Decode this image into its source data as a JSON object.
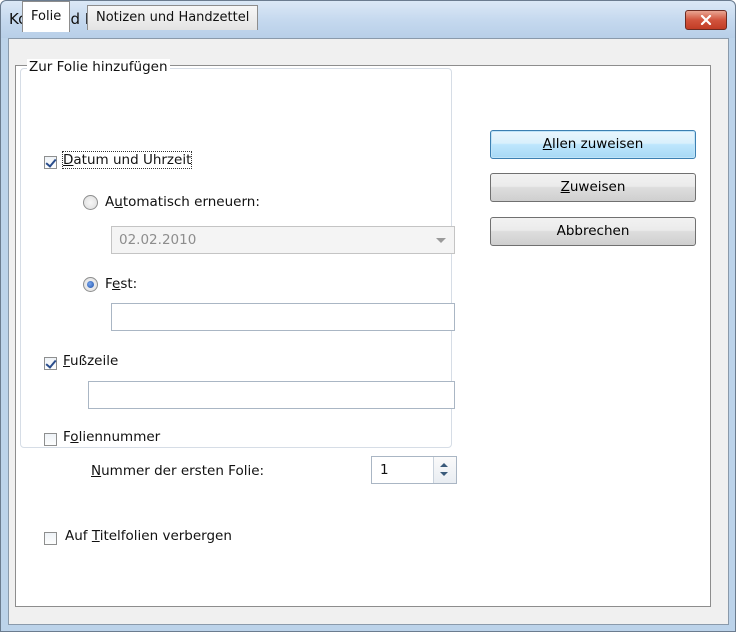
{
  "window": {
    "title": "Kopf- und Fußzeile"
  },
  "tabs": [
    {
      "label": "Folie",
      "active": true
    },
    {
      "label": "Notizen und Handzettel",
      "active": false
    }
  ],
  "group": {
    "label": "Zur Folie hinzufügen",
    "date_time": {
      "pre": "",
      "mn": "D",
      "post": "atum und Uhrzeit",
      "checked": true
    },
    "auto_update": {
      "pre": "A",
      "mn": "u",
      "post": "tomatisch erneuern:",
      "selected": false
    },
    "date_combo": {
      "value": "02.02.2010"
    },
    "fixed": {
      "pre": "F",
      "mn": "e",
      "post": "st:",
      "selected": true
    },
    "fixed_value": "",
    "footer": {
      "pre": "",
      "mn": "F",
      "post": "ußzeile",
      "checked": true
    },
    "footer_value": "",
    "slide_number": {
      "pre": "F",
      "mn": "o",
      "post": "liennummer",
      "checked": false
    },
    "first_number_label": {
      "pre": "",
      "mn": "N",
      "post": "ummer der ersten Folie:"
    },
    "first_number_value": "1"
  },
  "hide_title": {
    "pre": "Auf ",
    "mn": "T",
    "post": "itelfolien verbergen",
    "checked": false
  },
  "buttons": {
    "apply_all": {
      "pre": "",
      "mn": "A",
      "post": "llen zuweisen"
    },
    "apply": {
      "pre": "",
      "mn": "Z",
      "post": "uweisen"
    },
    "cancel": {
      "pre": "Abbrechen",
      "mn": "",
      "post": ""
    }
  },
  "colors": {
    "titlebar": "#c4d8ee",
    "close_button": "#c13c25",
    "default_button": "#bee6fd"
  }
}
